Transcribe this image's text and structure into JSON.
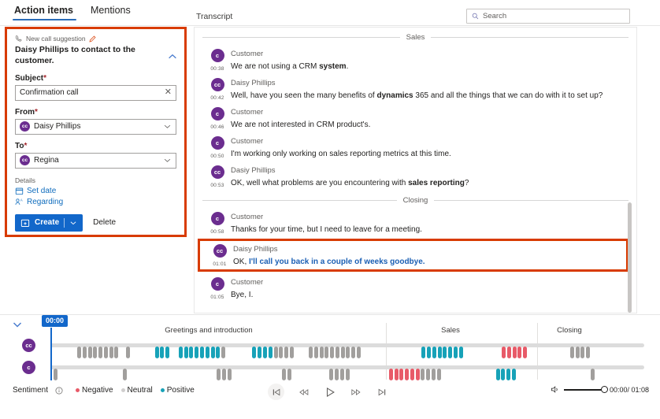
{
  "header": {
    "tabs": [
      {
        "label": "Action items",
        "active": true
      },
      {
        "label": "Mentions",
        "active": false
      }
    ],
    "transcript_label": "Transcript",
    "search": {
      "placeholder": "Search",
      "icon": "search-icon"
    }
  },
  "action_card": {
    "suggestion_label": "New call suggestion",
    "suggestion_icon": "phone-icon",
    "edit_icon": "pencil-icon",
    "collapse_icon": "chevron-up-icon",
    "title": "Daisy Phillips to contact to the customer.",
    "fields": {
      "subject": {
        "label": "Subject",
        "required": "*",
        "value": "Confirmation call",
        "clear_icon": "close-icon"
      },
      "from": {
        "label": "From",
        "required": "*",
        "value": "Daisy Phillips",
        "avatar_initials": "cc",
        "chevron": "chevron-down-icon"
      },
      "to": {
        "label": "To",
        "required": "*",
        "value": "Regina",
        "avatar_initials": "cc",
        "chevron": "chevron-down-icon"
      }
    },
    "details_label": "Details",
    "links": [
      {
        "label": "Set date",
        "icon": "calendar-icon"
      },
      {
        "label": "Regarding",
        "icon": "regarding-icon"
      }
    ],
    "create_button": {
      "label": "Create",
      "icon": "calendar-add-icon",
      "chevron": "chevron-down-icon"
    },
    "delete_button": {
      "label": "Delete"
    },
    "accent_color": "#d83b01",
    "primary_color": "#1267ca"
  },
  "transcript": {
    "sections": [
      {
        "name": "Sales",
        "messages": [
          {
            "avatar": "c",
            "speaker": "Customer",
            "time": "00:38",
            "text_pre": "We are not using a CRM ",
            "text_bold": "system",
            "text_post": ".",
            "highlight": false
          },
          {
            "avatar": "cc",
            "speaker": "Daisy Phillips",
            "time": "00:42",
            "text_pre": "Well, have you seen the many benefits of ",
            "text_bold": "dynamics",
            "text_post": " 365 and all the things that we can do with it to set up?",
            "highlight": false
          },
          {
            "avatar": "c",
            "speaker": "Customer",
            "time": "00:46",
            "text_pre": "We are not interested in CRM product's.",
            "text_bold": "",
            "text_post": "",
            "highlight": false
          },
          {
            "avatar": "c",
            "speaker": "Customer",
            "time": "00:50",
            "text_pre": "I'm working only working on sales reporting metrics at this time.",
            "text_bold": "",
            "text_post": "",
            "highlight": false
          },
          {
            "avatar": "cc",
            "speaker": "Dasiy Phillips",
            "time": "00:53",
            "text_pre": "OK, well what problems are you encountering with ",
            "text_bold": "sales reporting",
            "text_post": "?",
            "highlight": false
          }
        ]
      },
      {
        "name": "Closing",
        "messages": [
          {
            "avatar": "c",
            "speaker": "Customer",
            "time": "00:58",
            "text_pre": "Thanks for your time, but I need to leave for a meeting.",
            "text_bold": "",
            "text_post": "",
            "highlight": false
          },
          {
            "avatar": "cc",
            "speaker": "Daisy Phillips",
            "time": "01:01",
            "text_plain": "OK, ",
            "text_pre": "I'll call you back in a couple of weeks goodbye.",
            "text_bold": "",
            "text_post": "",
            "highlight": true
          },
          {
            "avatar": "c",
            "speaker": "Customer",
            "time": "01:05",
            "text_pre": "Bye, I.",
            "text_bold": "",
            "text_post": "",
            "highlight": false
          }
        ]
      }
    ]
  },
  "timeline": {
    "collapse_icon": "chevron-down-icon",
    "playhead_time": "00:00",
    "segment_labels": [
      {
        "label": "Greetings and introduction",
        "x_pct": 31.7
      },
      {
        "label": "Sales",
        "x_pct": 68.3
      },
      {
        "label": "Closing",
        "x_pct": 86.3
      }
    ],
    "segment_dividers_pct": [
      58.5,
      81.4
    ],
    "tracks": [
      {
        "avatar": "cc",
        "name": "agent-track"
      },
      {
        "avatar": "c",
        "name": "customer-track"
      }
    ],
    "sentiment_label": "Sentiment",
    "info_icon": "info-icon",
    "legend": [
      {
        "label": "Negative",
        "color": "#e85a68"
      },
      {
        "label": "Neutral",
        "color": "#d0cece"
      },
      {
        "label": "Positive",
        "color": "#17a2b8"
      }
    ],
    "transport": [
      {
        "name": "skip-to-start-button",
        "icon": "skip-start-icon"
      },
      {
        "name": "rewind-button",
        "icon": "rewind-icon"
      },
      {
        "name": "play-button",
        "icon": "play-icon"
      },
      {
        "name": "fast-forward-button",
        "icon": "fast-forward-icon"
      },
      {
        "name": "skip-to-end-button",
        "icon": "skip-end-icon"
      }
    ],
    "volume_icon": "volume-icon",
    "time_display": "00:00/ 01:08"
  },
  "chart_data": {
    "type": "timeline",
    "title": "Call sentiment timeline",
    "series": [
      {
        "name": "cc",
        "dots": [
          {
            "x": 4.5,
            "s": "neu"
          },
          {
            "x": 5.4,
            "s": "neu"
          },
          {
            "x": 6.3,
            "s": "neu"
          },
          {
            "x": 7.2,
            "s": "neu"
          },
          {
            "x": 8.1,
            "s": "neu"
          },
          {
            "x": 9.0,
            "s": "neu"
          },
          {
            "x": 9.9,
            "s": "neu"
          },
          {
            "x": 10.8,
            "s": "neu"
          },
          {
            "x": 12.7,
            "s": "neu"
          },
          {
            "x": 17.6,
            "s": "pos"
          },
          {
            "x": 18.5,
            "s": "pos"
          },
          {
            "x": 19.4,
            "s": "pos"
          },
          {
            "x": 21.6,
            "s": "pos"
          },
          {
            "x": 22.5,
            "s": "pos"
          },
          {
            "x": 23.4,
            "s": "pos"
          },
          {
            "x": 24.3,
            "s": "pos"
          },
          {
            "x": 25.2,
            "s": "pos"
          },
          {
            "x": 26.1,
            "s": "pos"
          },
          {
            "x": 27.0,
            "s": "pos"
          },
          {
            "x": 27.9,
            "s": "pos"
          },
          {
            "x": 28.8,
            "s": "neu"
          },
          {
            "x": 34.0,
            "s": "pos"
          },
          {
            "x": 34.9,
            "s": "pos"
          },
          {
            "x": 35.8,
            "s": "pos"
          },
          {
            "x": 36.7,
            "s": "pos"
          },
          {
            "x": 37.6,
            "s": "neu"
          },
          {
            "x": 38.5,
            "s": "neu"
          },
          {
            "x": 39.4,
            "s": "neu"
          },
          {
            "x": 40.3,
            "s": "neu"
          },
          {
            "x": 43.5,
            "s": "neu"
          },
          {
            "x": 44.4,
            "s": "neu"
          },
          {
            "x": 45.3,
            "s": "neu"
          },
          {
            "x": 46.2,
            "s": "neu"
          },
          {
            "x": 47.1,
            "s": "neu"
          },
          {
            "x": 48.0,
            "s": "neu"
          },
          {
            "x": 48.9,
            "s": "neu"
          },
          {
            "x": 49.8,
            "s": "neu"
          },
          {
            "x": 50.7,
            "s": "neu"
          },
          {
            "x": 51.6,
            "s": "neu"
          },
          {
            "x": 62.5,
            "s": "pos"
          },
          {
            "x": 63.4,
            "s": "pos"
          },
          {
            "x": 64.3,
            "s": "pos"
          },
          {
            "x": 65.2,
            "s": "pos"
          },
          {
            "x": 66.1,
            "s": "pos"
          },
          {
            "x": 67.0,
            "s": "pos"
          },
          {
            "x": 67.9,
            "s": "pos"
          },
          {
            "x": 68.8,
            "s": "pos"
          },
          {
            "x": 76.0,
            "s": "neg"
          },
          {
            "x": 76.9,
            "s": "neg"
          },
          {
            "x": 77.8,
            "s": "neg"
          },
          {
            "x": 78.7,
            "s": "neg"
          },
          {
            "x": 79.6,
            "s": "neg"
          },
          {
            "x": 87.5,
            "s": "neu"
          },
          {
            "x": 88.4,
            "s": "neu"
          },
          {
            "x": 89.3,
            "s": "neu"
          },
          {
            "x": 90.2,
            "s": "neu"
          }
        ]
      },
      {
        "name": "c",
        "dots": [
          {
            "x": 0.5,
            "s": "neu"
          },
          {
            "x": 12.2,
            "s": "neu"
          },
          {
            "x": 28.0,
            "s": "neu"
          },
          {
            "x": 28.9,
            "s": "neu"
          },
          {
            "x": 29.8,
            "s": "neu"
          },
          {
            "x": 39.0,
            "s": "neu"
          },
          {
            "x": 39.9,
            "s": "neu"
          },
          {
            "x": 47.0,
            "s": "neu"
          },
          {
            "x": 47.9,
            "s": "neu"
          },
          {
            "x": 48.8,
            "s": "neu"
          },
          {
            "x": 49.7,
            "s": "neu"
          },
          {
            "x": 57.0,
            "s": "neg"
          },
          {
            "x": 57.9,
            "s": "neg"
          },
          {
            "x": 58.8,
            "s": "neg"
          },
          {
            "x": 59.7,
            "s": "neg"
          },
          {
            "x": 60.6,
            "s": "neg"
          },
          {
            "x": 61.5,
            "s": "neg"
          },
          {
            "x": 62.4,
            "s": "neu"
          },
          {
            "x": 63.3,
            "s": "neu"
          },
          {
            "x": 64.2,
            "s": "neu"
          },
          {
            "x": 65.1,
            "s": "neu"
          },
          {
            "x": 75.0,
            "s": "pos"
          },
          {
            "x": 75.9,
            "s": "pos"
          },
          {
            "x": 76.8,
            "s": "pos"
          },
          {
            "x": 77.7,
            "s": "pos"
          },
          {
            "x": 91.0,
            "s": "neu"
          }
        ]
      }
    ]
  }
}
